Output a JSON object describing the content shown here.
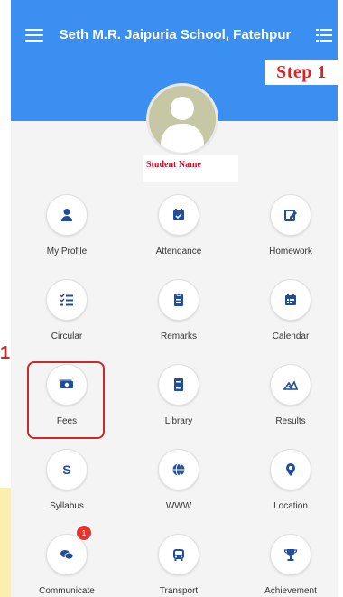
{
  "header": {
    "title": "Seth M.R. Jaipuria School, Fatehpur",
    "step_badge": "Step 1",
    "menu_icon": "hamburger-icon",
    "list_icon": "list-icon"
  },
  "profile": {
    "student_name": "Student Name",
    "avatar_icon": "user-avatar-icon"
  },
  "annotation": {
    "step_number": "1",
    "highlight_color": "#c92a2a"
  },
  "colors": {
    "header_bg": "#3b8ff0",
    "icon_color": "#1f4e9c",
    "badge_red": "#e3342f"
  },
  "menu": [
    {
      "label": "My Profile",
      "icon": "user-icon"
    },
    {
      "label": "Attendance",
      "icon": "calendar-check-icon"
    },
    {
      "label": "Homework",
      "icon": "edit-icon"
    },
    {
      "label": "Circular",
      "icon": "checklist-icon"
    },
    {
      "label": "Remarks",
      "icon": "clipboard-icon"
    },
    {
      "label": "Calendar",
      "icon": "calendar-icon"
    },
    {
      "label": "Fees",
      "icon": "money-icon"
    },
    {
      "label": "Library",
      "icon": "book-icon"
    },
    {
      "label": "Results",
      "icon": "chart-icon"
    },
    {
      "label": "Syllabus",
      "icon": "s-icon"
    },
    {
      "label": "WWW",
      "icon": "globe-icon"
    },
    {
      "label": "Location",
      "icon": "location-pin-icon"
    },
    {
      "label": "Communicate",
      "icon": "chat-icon",
      "badge": "1"
    },
    {
      "label": "Transport",
      "icon": "bus-icon"
    },
    {
      "label": "Achievement",
      "icon": "trophy-icon"
    }
  ]
}
